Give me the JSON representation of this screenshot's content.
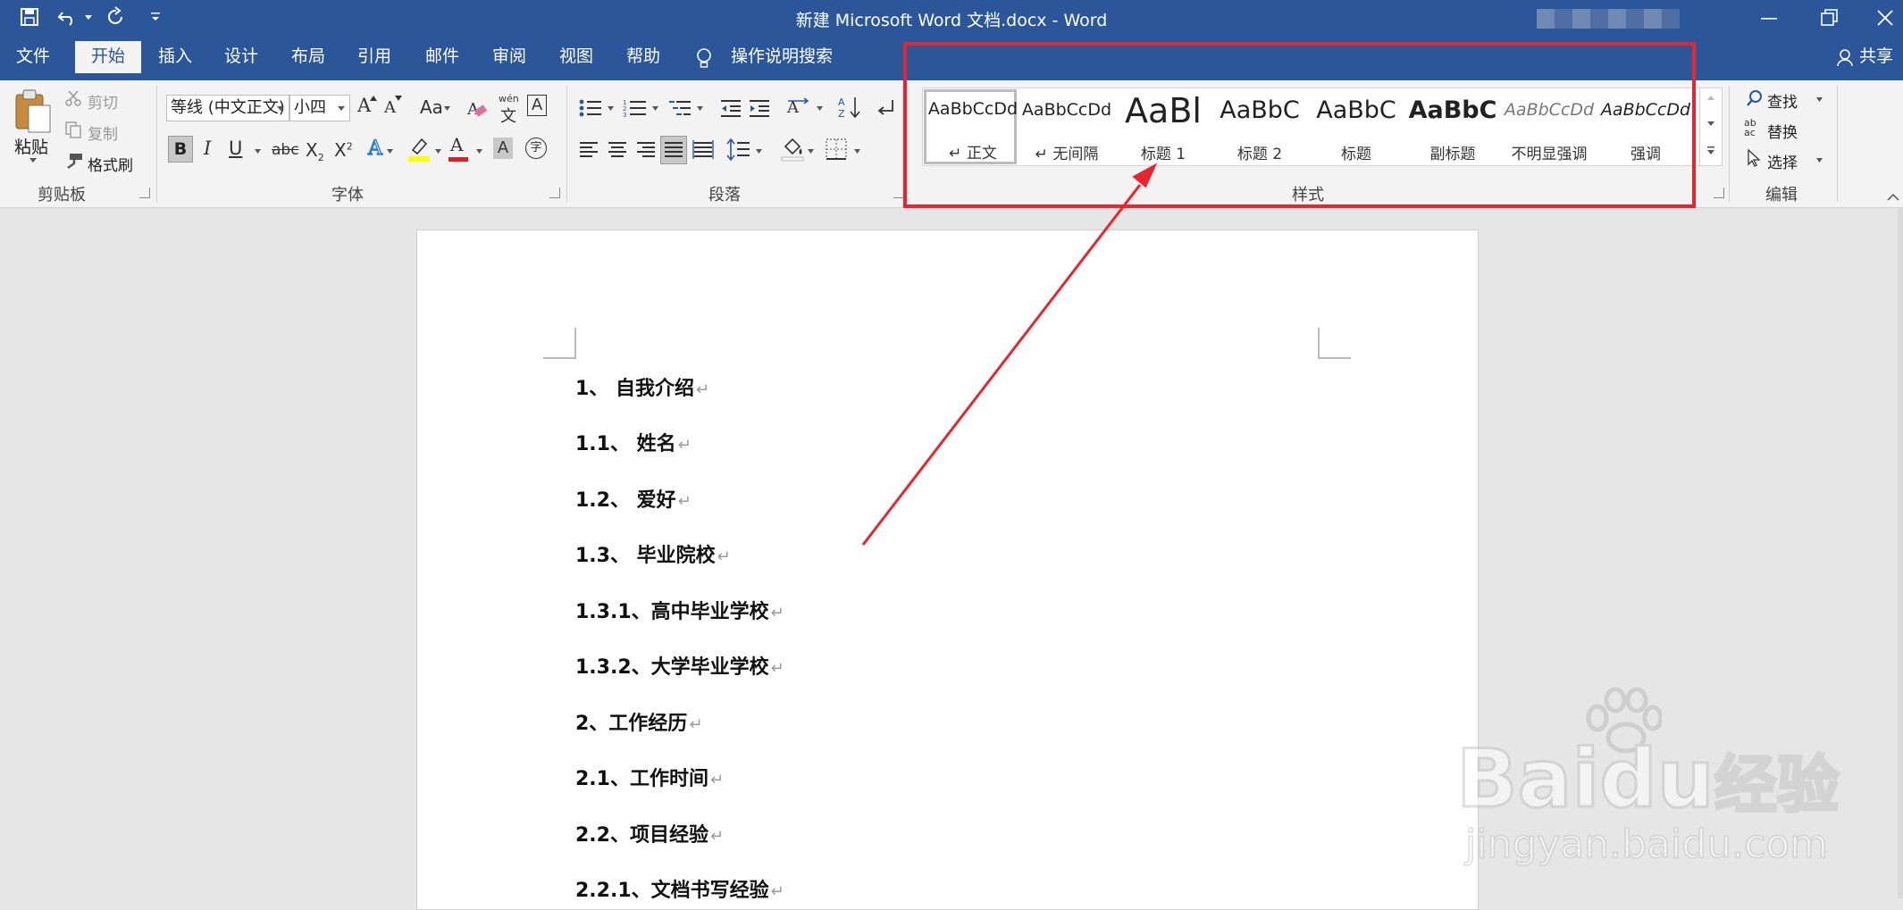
{
  "titlebar": {
    "title": "新建 Microsoft Word 文档.docx  -  Word"
  },
  "tabs": [
    {
      "label": "文件"
    },
    {
      "label": "开始"
    },
    {
      "label": "插入"
    },
    {
      "label": "设计"
    },
    {
      "label": "布局"
    },
    {
      "label": "引用"
    },
    {
      "label": "邮件"
    },
    {
      "label": "审阅"
    },
    {
      "label": "视图"
    },
    {
      "label": "帮助"
    }
  ],
  "tell_me": "操作说明搜索",
  "share": "共享",
  "clipboard": {
    "paste": "粘贴",
    "cut": "剪切",
    "copy": "复制",
    "painter": "格式刷",
    "group": "剪贴板"
  },
  "font": {
    "name": "等线 (中文正文)",
    "size": "小四",
    "group": "字体",
    "grow": "A",
    "shrink": "A",
    "case": "Aa",
    "phonetic_top": "wén",
    "phonetic_bottom": "文",
    "border_char": "A",
    "bold": "B",
    "italic": "I",
    "underline": "U",
    "strike": "abc",
    "sub": "X",
    "sub_idx": "2",
    "sup": "X",
    "sup_idx": "2",
    "effects": "A",
    "color_a": "A",
    "shade_a": "A",
    "circle": "字"
  },
  "paragraph": {
    "group": "段落"
  },
  "styles": {
    "group": "样式",
    "items": [
      {
        "preview": "AaBbCcDd",
        "name": "正文"
      },
      {
        "preview": "AaBbCcDd",
        "name": "无间隔"
      },
      {
        "preview": "AaBl",
        "name": "标题 1"
      },
      {
        "preview": "AaBbC",
        "name": "标题 2"
      },
      {
        "preview": "AaBbC",
        "name": "标题"
      },
      {
        "preview": "AaBbC",
        "name": "副标题"
      },
      {
        "preview": "AaBbCcDd",
        "name": "不明显强调"
      },
      {
        "preview": "AaBbCcDd",
        "name": "强调"
      }
    ]
  },
  "editing": {
    "find": "查找",
    "replace": "替换",
    "select": "选择",
    "group": "编辑",
    "ab": "ab",
    "ac": "ac"
  },
  "document": {
    "paragraphs": [
      {
        "text": "1、    自我介绍"
      },
      {
        "text": "1.1、  姓名"
      },
      {
        "text": "1.2、  爱好"
      },
      {
        "text": "1.3、  毕业院校"
      },
      {
        "text": "1.3.1、高中毕业学校"
      },
      {
        "text": "1.3.2、大学毕业学校"
      },
      {
        "text": "2、工作经历"
      },
      {
        "text": "2.1、工作时间"
      },
      {
        "text": "2.2、项目经验"
      },
      {
        "text": "2.2.1、文档书写经验"
      }
    ],
    "paragraph_mark": "↵"
  },
  "watermark": {
    "brand_a": "Bai",
    "brand_b": "du",
    "brand_c": "经验",
    "url": "jingyan.baidu.com"
  },
  "colors": {
    "ribbon_blue": "#2b579a",
    "annotation_red": "#e8242e"
  }
}
